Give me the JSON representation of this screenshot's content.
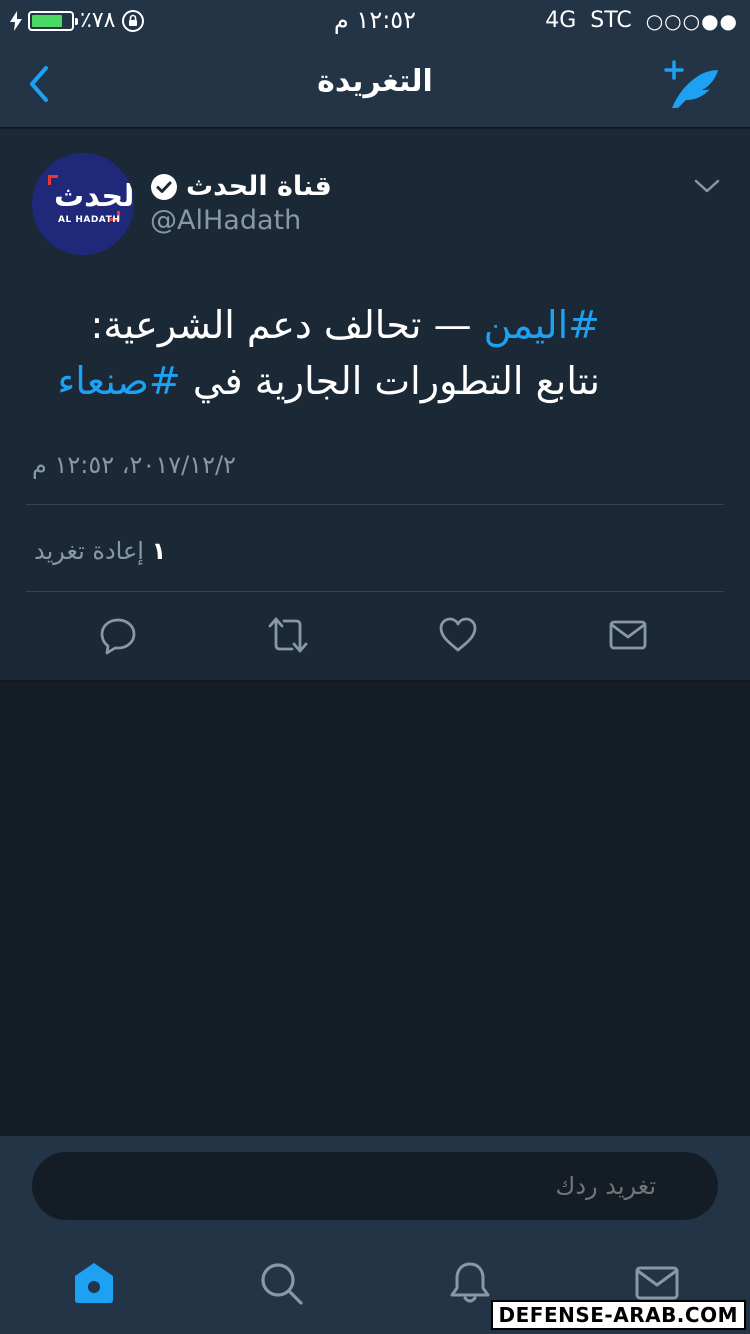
{
  "status_bar": {
    "battery": "٪٧٨",
    "battery_level": 0.78,
    "time": "١٢:٥٢ م",
    "network": "4G",
    "carrier": "STC",
    "signal": "○○○●●"
  },
  "nav": {
    "title": "التغريدة",
    "back_icon": "chevron-left-icon",
    "compose_icon": "feather-plus-icon",
    "accent": "#1da1f2"
  },
  "tweet": {
    "display_name": "قناة الحدث",
    "handle": "@AlHadath",
    "avatar": {
      "logo_ar": "الحدث",
      "logo_en": "AL HADATH"
    },
    "text_parts": [
      {
        "type": "hashtag",
        "text": "#اليمن"
      },
      {
        "type": "text",
        "text": " — تحالف دعم الشرعية: نتابع التطورات الجارية في "
      },
      {
        "type": "hashtag",
        "text": "#صنعاء"
      }
    ],
    "timestamp": "٢٠١٧/١٢/٢، ١٢:٥٢ م",
    "retweet_count": "١",
    "retweet_label": "إعادة تغريد"
  },
  "reply": {
    "placeholder": "تغريد ردك"
  },
  "tabs": [
    "home-icon",
    "search-icon",
    "bell-icon",
    "envelope-icon"
  ],
  "watermark": "DEFENSE-ARAB.COM"
}
